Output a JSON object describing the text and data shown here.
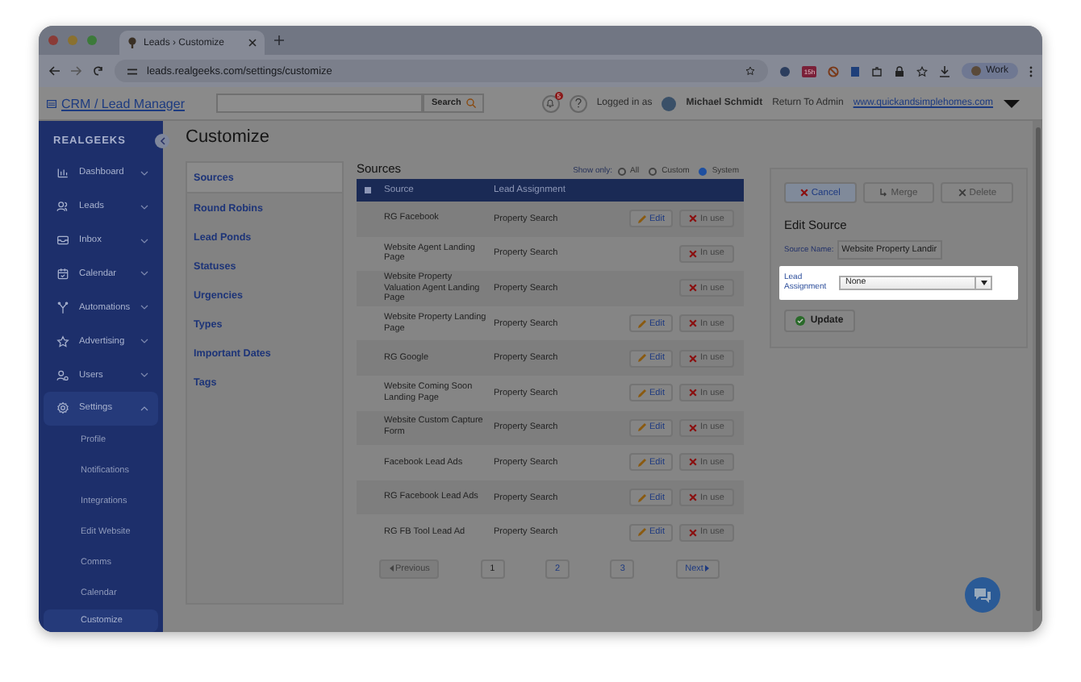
{
  "browser": {
    "tab_title": "Leads › Customize",
    "url": "leads.realgeeks.com/settings/customize",
    "extension_badge": "15h",
    "profile": "Work"
  },
  "header": {
    "app_link": "CRM / Lead Manager",
    "search_button": "Search",
    "notification_count": "5",
    "logged_in_label": "Logged in as",
    "user_name": "Michael Schmidt",
    "return_link": "Return To Admin",
    "website_link": "www.quickandsimplehomes.com"
  },
  "sidebar": {
    "logo": "REALGEEKS",
    "items": [
      {
        "label": "Dashboard",
        "expanded": false
      },
      {
        "label": "Leads",
        "expanded": false
      },
      {
        "label": "Inbox",
        "expanded": false
      },
      {
        "label": "Calendar",
        "expanded": false
      },
      {
        "label": "Automations",
        "expanded": false
      },
      {
        "label": "Advertising",
        "expanded": false
      },
      {
        "label": "Users",
        "expanded": false
      },
      {
        "label": "Settings",
        "expanded": true,
        "children": [
          {
            "label": "Profile",
            "selected": false
          },
          {
            "label": "Notifications",
            "selected": false
          },
          {
            "label": "Integrations",
            "selected": false
          },
          {
            "label": "Edit Website",
            "selected": false
          },
          {
            "label": "Comms",
            "selected": false
          },
          {
            "label": "Calendar",
            "selected": false
          },
          {
            "label": "Customize",
            "selected": true
          }
        ]
      }
    ]
  },
  "page_title": "Customize",
  "nav": [
    {
      "label": "Sources",
      "selected": true
    },
    {
      "label": "Round Robins",
      "selected": false
    },
    {
      "label": "Lead Ponds",
      "selected": false
    },
    {
      "label": "Statuses",
      "selected": false
    },
    {
      "label": "Urgencies",
      "selected": false
    },
    {
      "label": "Types",
      "selected": false
    },
    {
      "label": "Important Dates",
      "selected": false
    },
    {
      "label": "Tags",
      "selected": false
    }
  ],
  "sources": {
    "title": "Sources",
    "show_only_label": "Show only:",
    "filters": [
      {
        "label": "All",
        "selected": false
      },
      {
        "label": "Custom",
        "selected": false
      },
      {
        "label": "System",
        "selected": true
      }
    ],
    "select_all_checked": false,
    "columns": [
      "Source",
      "Lead Assignment"
    ],
    "rows": [
      {
        "source": "RG Facebook",
        "assignment": "Property Search",
        "edit": "Edit",
        "status": "In use"
      },
      {
        "source": "Website Agent Landing Page",
        "assignment": "Property Search",
        "status": "In use"
      },
      {
        "source": "Website Property Valuation Agent Landing Page",
        "assignment": "Property Search",
        "status": "In use"
      },
      {
        "source": "Website Property Landing Page",
        "assignment": "Property Search",
        "edit": "Edit",
        "status": "In use"
      },
      {
        "source": "RG Google",
        "assignment": "Property Search",
        "edit": "Edit",
        "status": "In use"
      },
      {
        "source": "Website Coming Soon Landing Page",
        "assignment": "Property Search",
        "edit": "Edit",
        "status": "In use"
      },
      {
        "source": "Website Custom Capture Form",
        "assignment": "Property Search",
        "edit": "Edit",
        "status": "In use"
      },
      {
        "source": "Facebook Lead Ads",
        "assignment": "Property Search",
        "edit": "Edit",
        "status": "In use"
      },
      {
        "source": "RG Facebook Lead Ads",
        "assignment": "Property Search",
        "edit": "Edit",
        "status": "In use"
      },
      {
        "source": "RG FB Tool Lead Ad",
        "assignment": "Property Search",
        "edit": "Edit",
        "status": "In use"
      }
    ],
    "pagination": {
      "previous": {
        "label": "Previous",
        "disabled": true
      },
      "pages": [
        {
          "label": "1",
          "selected": true
        },
        {
          "label": "2",
          "selected": false
        },
        {
          "label": "3",
          "selected": false
        }
      ],
      "next": {
        "label": "Next",
        "disabled": false
      }
    }
  },
  "edit_panel": {
    "buttons": [
      {
        "label": "Cancel",
        "kind": "cancel",
        "disabled": false
      },
      {
        "label": "Merge",
        "kind": "merge",
        "disabled": true
      },
      {
        "label": "Delete",
        "kind": "delete",
        "disabled": true
      }
    ],
    "title": "Edit Source",
    "source_name_label": "Source Name:",
    "source_name_value": "Website Property Landir",
    "lead_assignment_label": "Lead Assignment",
    "lead_assignment_value": "None",
    "update_button": "Update"
  }
}
